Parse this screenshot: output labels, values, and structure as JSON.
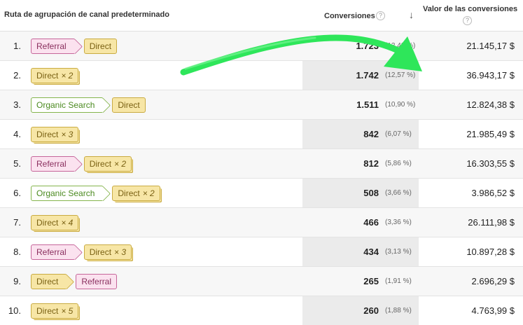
{
  "header": {
    "path_label": "Ruta de agrupación de canal predeterminado",
    "conversions_label": "Conversiones",
    "value_label": "Valor de las conversiones",
    "help_glyph": "?",
    "sort_glyph": "↓"
  },
  "rows": [
    {
      "index": "1.",
      "chips": [
        {
          "type": "referral",
          "label": "Referral",
          "count": ""
        },
        {
          "type": "direct",
          "label": "Direct",
          "count": ""
        }
      ],
      "conversions": "1.723",
      "percent": "(12,43 %)",
      "value": "21.145,17 $"
    },
    {
      "index": "2.",
      "chips": [
        {
          "type": "direct",
          "label": "Direct",
          "count": "× 2"
        }
      ],
      "conversions": "1.742",
      "percent": "(12,57 %)",
      "value": "36.943,17 $"
    },
    {
      "index": "3.",
      "chips": [
        {
          "type": "organic",
          "label": "Organic Search",
          "count": ""
        },
        {
          "type": "direct",
          "label": "Direct",
          "count": ""
        }
      ],
      "conversions": "1.511",
      "percent": "(10,90 %)",
      "value": "12.824,38 $"
    },
    {
      "index": "4.",
      "chips": [
        {
          "type": "direct",
          "label": "Direct",
          "count": "× 3"
        }
      ],
      "conversions": "842",
      "percent": "(6,07 %)",
      "value": "21.985,49 $"
    },
    {
      "index": "5.",
      "chips": [
        {
          "type": "referral",
          "label": "Referral",
          "count": ""
        },
        {
          "type": "direct",
          "label": "Direct",
          "count": "× 2"
        }
      ],
      "conversions": "812",
      "percent": "(5,86 %)",
      "value": "16.303,55 $"
    },
    {
      "index": "6.",
      "chips": [
        {
          "type": "organic",
          "label": "Organic Search",
          "count": ""
        },
        {
          "type": "direct",
          "label": "Direct",
          "count": "× 2"
        }
      ],
      "conversions": "508",
      "percent": "(3,66 %)",
      "value": "3.986,52 $"
    },
    {
      "index": "7.",
      "chips": [
        {
          "type": "direct",
          "label": "Direct",
          "count": "× 4"
        }
      ],
      "conversions": "466",
      "percent": "(3,36 %)",
      "value": "26.111,98 $"
    },
    {
      "index": "8.",
      "chips": [
        {
          "type": "referral",
          "label": "Referral",
          "count": ""
        },
        {
          "type": "direct",
          "label": "Direct",
          "count": "× 3"
        }
      ],
      "conversions": "434",
      "percent": "(3,13 %)",
      "value": "10.897,28 $"
    },
    {
      "index": "9.",
      "chips": [
        {
          "type": "direct",
          "label": "Direct",
          "count": ""
        },
        {
          "type": "referral",
          "label": "Referral",
          "count": ""
        }
      ],
      "conversions": "265",
      "percent": "(1,91 %)",
      "value": "2.696,29 $"
    },
    {
      "index": "10.",
      "chips": [
        {
          "type": "direct",
          "label": "Direct",
          "count": "× 5"
        }
      ],
      "conversions": "260",
      "percent": "(1,88 %)",
      "value": "4.763,99 $"
    }
  ],
  "annotation": {
    "arrow_color": "#2ee65a"
  }
}
